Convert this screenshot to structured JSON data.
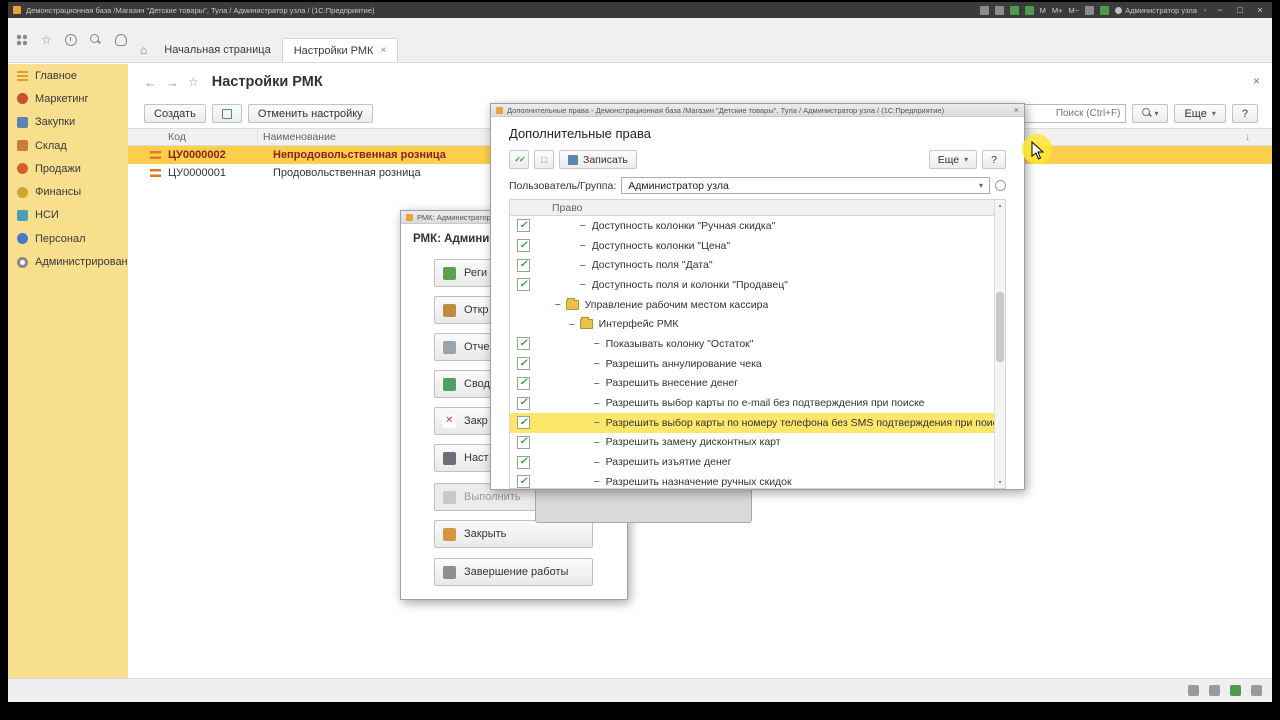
{
  "titlebar": {
    "title": "Демонстрационная база /Магазин \"Детские товары\", Тула / Администратор узла /  (1С:Предприятие)",
    "memory": [
      "M",
      "M+",
      "M−"
    ],
    "user": "Администратор узла"
  },
  "tabs": {
    "home": "Начальная страница",
    "active": "Настройки РМК"
  },
  "sidebar": {
    "items": [
      {
        "label": "Главное"
      },
      {
        "label": "Маркетинг"
      },
      {
        "label": "Закупки"
      },
      {
        "label": "Склад"
      },
      {
        "label": "Продажи"
      },
      {
        "label": "Финансы"
      },
      {
        "label": "НСИ"
      },
      {
        "label": "Персонал"
      },
      {
        "label": "Администрирование"
      }
    ]
  },
  "main": {
    "title": "Настройки РМК",
    "create": "Создать",
    "cancel_setting": "Отменить настройку",
    "search_placeholder": "Поиск (Ctrl+F)",
    "more": "Еще",
    "help": "?",
    "columns": {
      "code": "Код",
      "name": "Наименование"
    },
    "rows": [
      {
        "code": "ЦУ0000002",
        "name": "Непродовольственная розница"
      },
      {
        "code": "ЦУ0000001",
        "name": "Продовольственная розница"
      }
    ]
  },
  "rmk": {
    "title": "РМК: Администратор",
    "heading": "РМК: Администр",
    "buttons": [
      {
        "label": "Реги"
      },
      {
        "label": "Откр"
      },
      {
        "label": "Отче"
      },
      {
        "label": "Свод"
      },
      {
        "label": "Закр"
      },
      {
        "label": "Наст"
      },
      {
        "label": "Выполнить"
      },
      {
        "label": "Закрыть"
      },
      {
        "label": "Завершение работы"
      }
    ]
  },
  "rights": {
    "title": "Дополнительные права - Демонстрационная база /Магазин \"Детские товары\", Тула / Администратор узла /  (1С:Предприятие)",
    "heading": "Дополнительные права",
    "save": "Записать",
    "more": "Еще",
    "help": "?",
    "user_label": "Пользователь/Группа:",
    "user_value": "Администратор узла",
    "column": "Право",
    "rows": [
      {
        "text": "Доступность колонки \"Ручная скидка\"",
        "checked": true
      },
      {
        "text": "Доступность колонки \"Цена\"",
        "checked": true
      },
      {
        "text": "Доступность поля \"Дата\"",
        "checked": true
      },
      {
        "text": "Доступность поля и колонки \"Продавец\"",
        "checked": true
      },
      {
        "text": "Управление рабочим местом кассира",
        "folder": true
      },
      {
        "text": "Интерфейс РМК",
        "folder": true
      },
      {
        "text": "Показывать колонку \"Остаток\"",
        "checked": true
      },
      {
        "text": "Разрешить аннулирование чека",
        "checked": true
      },
      {
        "text": "Разрешить внесение денег",
        "checked": true
      },
      {
        "text": "Разрешить выбор карты по e-mail без подтверждения при поиске",
        "checked": true
      },
      {
        "text": "Разрешить выбор карты по номеру телефона без SMS подтверждения при поиске",
        "checked": true,
        "highlighted": true
      },
      {
        "text": "Разрешить замену дисконтных карт",
        "checked": true
      },
      {
        "text": "Разрешить изъятие денег",
        "checked": true
      },
      {
        "text": "Разрешить назначение ручных скидок",
        "checked": true
      }
    ]
  },
  "icons": {
    "close": "×",
    "minimize": "−",
    "maximize": "□",
    "back": "←",
    "forward": "→",
    "star": "☆",
    "home": "⌂",
    "dropdown": "▾",
    "sort": "↓",
    "check": "✓",
    "marker": "–",
    "up": "▴",
    "down": "▾"
  }
}
